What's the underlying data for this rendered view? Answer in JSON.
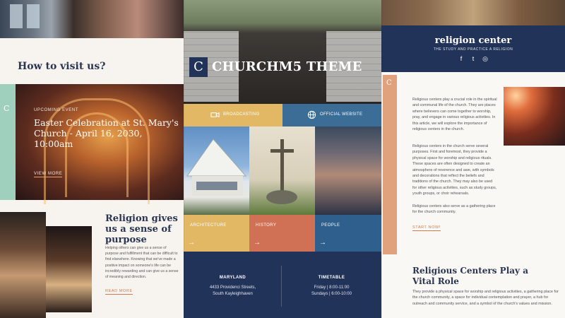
{
  "left": {
    "visit_title": "How to visit us?",
    "brand_initial": "C",
    "event_label": "UPCOMING EVENT",
    "event_title": "Easter Celebration at St. Mary's Church - April 16, 2030, 10:00am",
    "event_more": "VIEW MORE",
    "purpose_title": "Religion gives us a sense of purpose",
    "purpose_body": "Helping others can give us a sense of purpose and fulfillment that can be difficult to find elsewhere. Knowing that we've made a positive impact on someone's life can be incredibly rewarding and can give us a sense of meaning and direction.",
    "purpose_more": "READ MORE"
  },
  "middle": {
    "brand_initial": "C",
    "site_title": "CHURCHM5 THEME",
    "buttons": [
      {
        "label": "BROADCASTING",
        "icon": "video-icon",
        "color": "#e2b865"
      },
      {
        "label": "OFFICIAL WEBSITE",
        "icon": "globe-icon",
        "color": "#3b6d97"
      }
    ],
    "tiles": [
      {
        "label": "ARCHITECTURE",
        "arrow": "→",
        "color": "#e2b865"
      },
      {
        "label": "HISTORY",
        "arrow": "→",
        "color": "#d07156"
      },
      {
        "label": "PEOPLE",
        "arrow": "→",
        "color": "#2f5f8c"
      }
    ],
    "location": {
      "heading": "MARYLAND",
      "line1": "4433 Providenci Streets,",
      "line2": "South Kayleighhaven"
    },
    "timetable": {
      "heading": "TIMETABLE",
      "line1": "Friday | 8:00-11:00",
      "line2": "Sundays | 6:00-10:00"
    }
  },
  "right": {
    "brand": "religion center",
    "tagline": "THE STUDY AND PRACTICE A RELIGION",
    "social": [
      {
        "icon": "facebook-icon",
        "glyph": "f"
      },
      {
        "icon": "twitter-icon",
        "glyph": "t"
      },
      {
        "icon": "instagram-icon",
        "glyph": "◎"
      }
    ],
    "brand_initial": "C",
    "para1": "Religious centers play a crucial role in the spiritual and communal life of the church. They are places where believers can come together to worship, pray, and engage in various religious activities. In this article, we will explore the importance of religious centers in the church.",
    "para2": "Religious centers in the church serve several purposes. First and foremost, they provide a physical space for worship and religious rituals. These spaces are often designed to create an atmosphere of reverence and awe, with symbols and decorations that reflect the beliefs and traditions of the church. They may also be used for other religious activities, such as study groups, youth groups, or choir rehearsals.",
    "para3": "Religious centers also serve as a gathering place for the church community.",
    "start_now": "START NOW!",
    "heading": "Religious Centers Play a Vital Role",
    "heading_body": "They provide a physical space for worship and religious activities, a gathering place for the church community, a space for individual contemplation and prayer, a hub for outreach and community service, and a symbol of the church's values and mission."
  }
}
